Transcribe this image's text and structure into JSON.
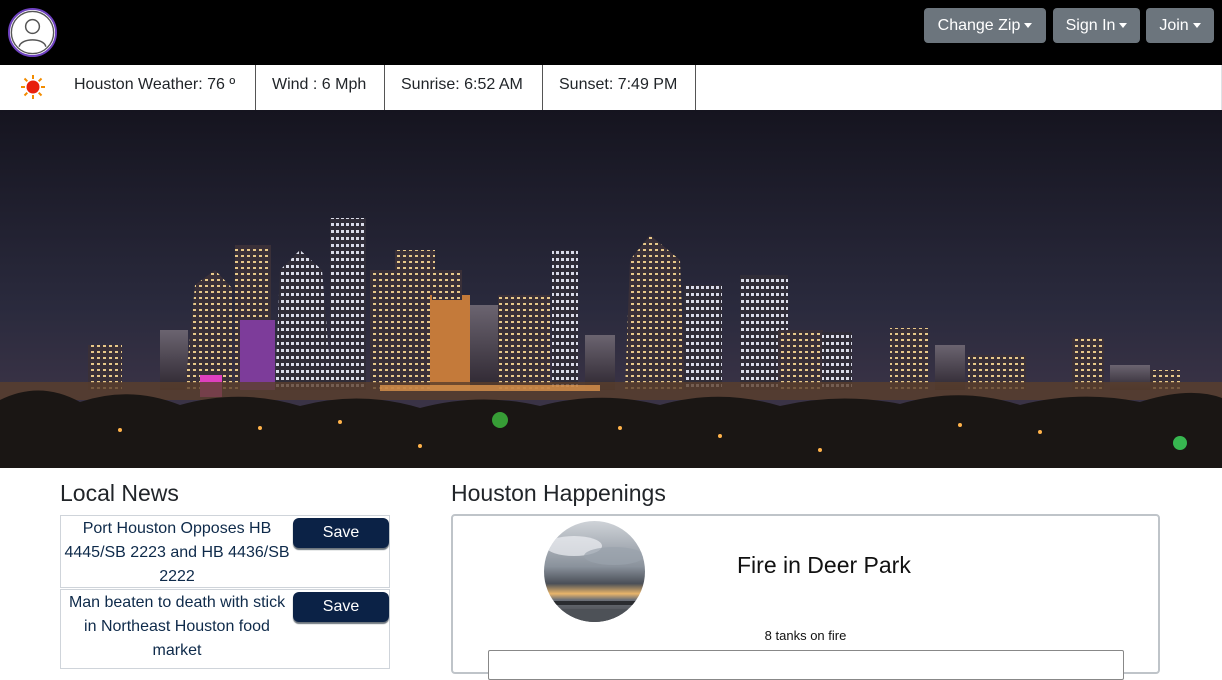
{
  "navbar": {
    "avatar_icon": "user-avatar-icon",
    "buttons": [
      {
        "label": "Change Zip"
      },
      {
        "label": "Sign In"
      },
      {
        "label": "Join"
      }
    ],
    "background": "#000000",
    "button_color": "#6c757d"
  },
  "weather": {
    "icon": "sun-icon",
    "temperature": "Houston Weather: 76 º",
    "wind": "Wind : 6 Mph",
    "sunrise": "Sunrise: 6:52 AM",
    "sunset": "Sunset: 7:49 PM"
  },
  "hero": {
    "image": "houston-skyline-night"
  },
  "local_news": {
    "title": "Local News",
    "items": [
      {
        "headline": "Port Houston Opposes HB 4445/SB 2223 and HB 4436/SB 2222",
        "save_label": "Save"
      },
      {
        "headline": "Man beaten to death with stick in Northeast Houston food market",
        "save_label": "Save"
      }
    ],
    "save_color": "#0b2246"
  },
  "happenings": {
    "title": "Houston Happenings",
    "event": {
      "image": "cloudy-sunset-photo",
      "title": "Fire in Deer Park",
      "description": "8 tanks on fire"
    }
  }
}
